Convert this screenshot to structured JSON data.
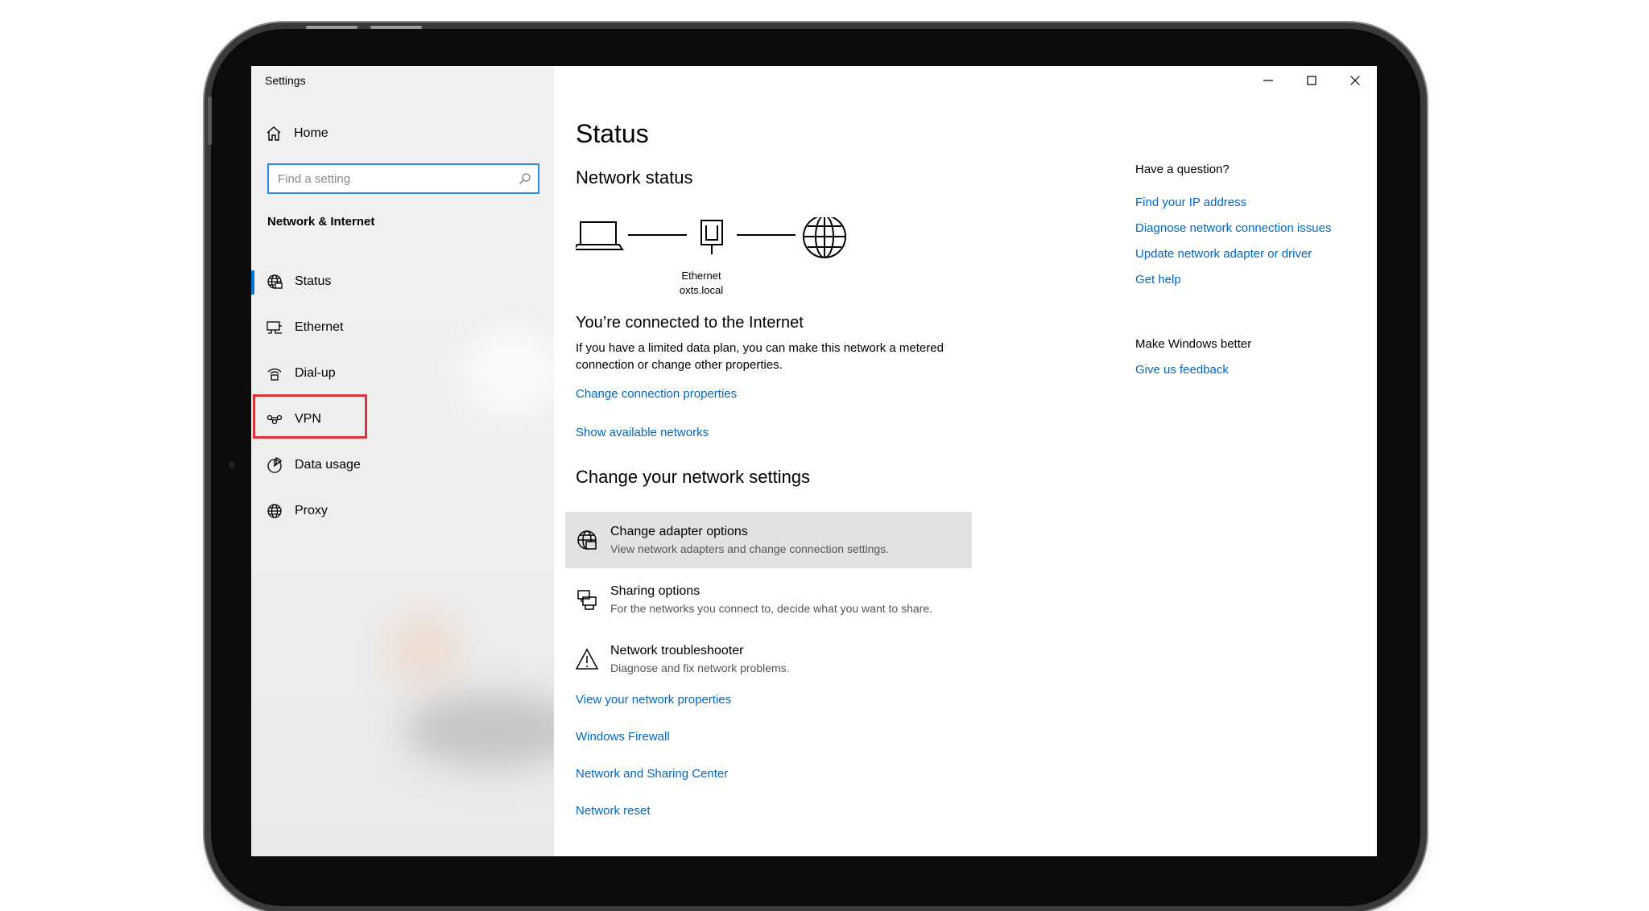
{
  "window": {
    "title": "Settings",
    "controls": [
      "minimize-icon",
      "maximize-icon",
      "close-icon"
    ]
  },
  "sidebar": {
    "home_label": "Home",
    "search_placeholder": "Find a setting",
    "section_title": "Network & Internet",
    "items": [
      {
        "label": "Status",
        "icon": "status-globe-icon",
        "selected": true
      },
      {
        "label": "Ethernet",
        "icon": "ethernet-icon"
      },
      {
        "label": "Dial-up",
        "icon": "dialup-icon"
      },
      {
        "label": "VPN",
        "icon": "vpn-icon",
        "highlighted": true
      },
      {
        "label": "Data usage",
        "icon": "data-usage-icon"
      },
      {
        "label": "Proxy",
        "icon": "globe-icon"
      }
    ]
  },
  "main": {
    "title": "Status",
    "network_status_heading": "Network status",
    "diagram": {
      "adapter_label": "Ethernet",
      "network_label": "oxts.local"
    },
    "connected_title": "You’re connected to the Internet",
    "connected_desc": "If you have a limited data plan, you can make this network a metered connection or change other properties.",
    "links_top": [
      "Change connection properties",
      "Show available networks"
    ],
    "change_settings_heading": "Change your network settings",
    "options": [
      {
        "title": "Change adapter options",
        "desc": "View network adapters and change connection settings.",
        "icon": "adapter-globe-icon"
      },
      {
        "title": "Sharing options",
        "desc": "For the networks you connect to, decide what you want to share.",
        "icon": "sharing-printer-icon"
      },
      {
        "title": "Network troubleshooter",
        "desc": "Diagnose and fix network problems.",
        "icon": "warning-icon"
      }
    ],
    "links_bottom": [
      "View your network properties",
      "Windows Firewall",
      "Network and Sharing Center",
      "Network reset"
    ]
  },
  "right_panel": {
    "question_heading": "Have a question?",
    "help_links": [
      "Find your IP address",
      "Diagnose network connection issues",
      "Update network adapter or driver",
      "Get help"
    ],
    "feedback_heading": "Make Windows better",
    "feedback_link": "Give us feedback"
  },
  "colors": {
    "accent": "#0078d7",
    "link": "#0067c0",
    "highlight_box": "#d9343b",
    "sidebar_bg": "#f0f0f0",
    "hover_bg": "#e2e2e2"
  }
}
